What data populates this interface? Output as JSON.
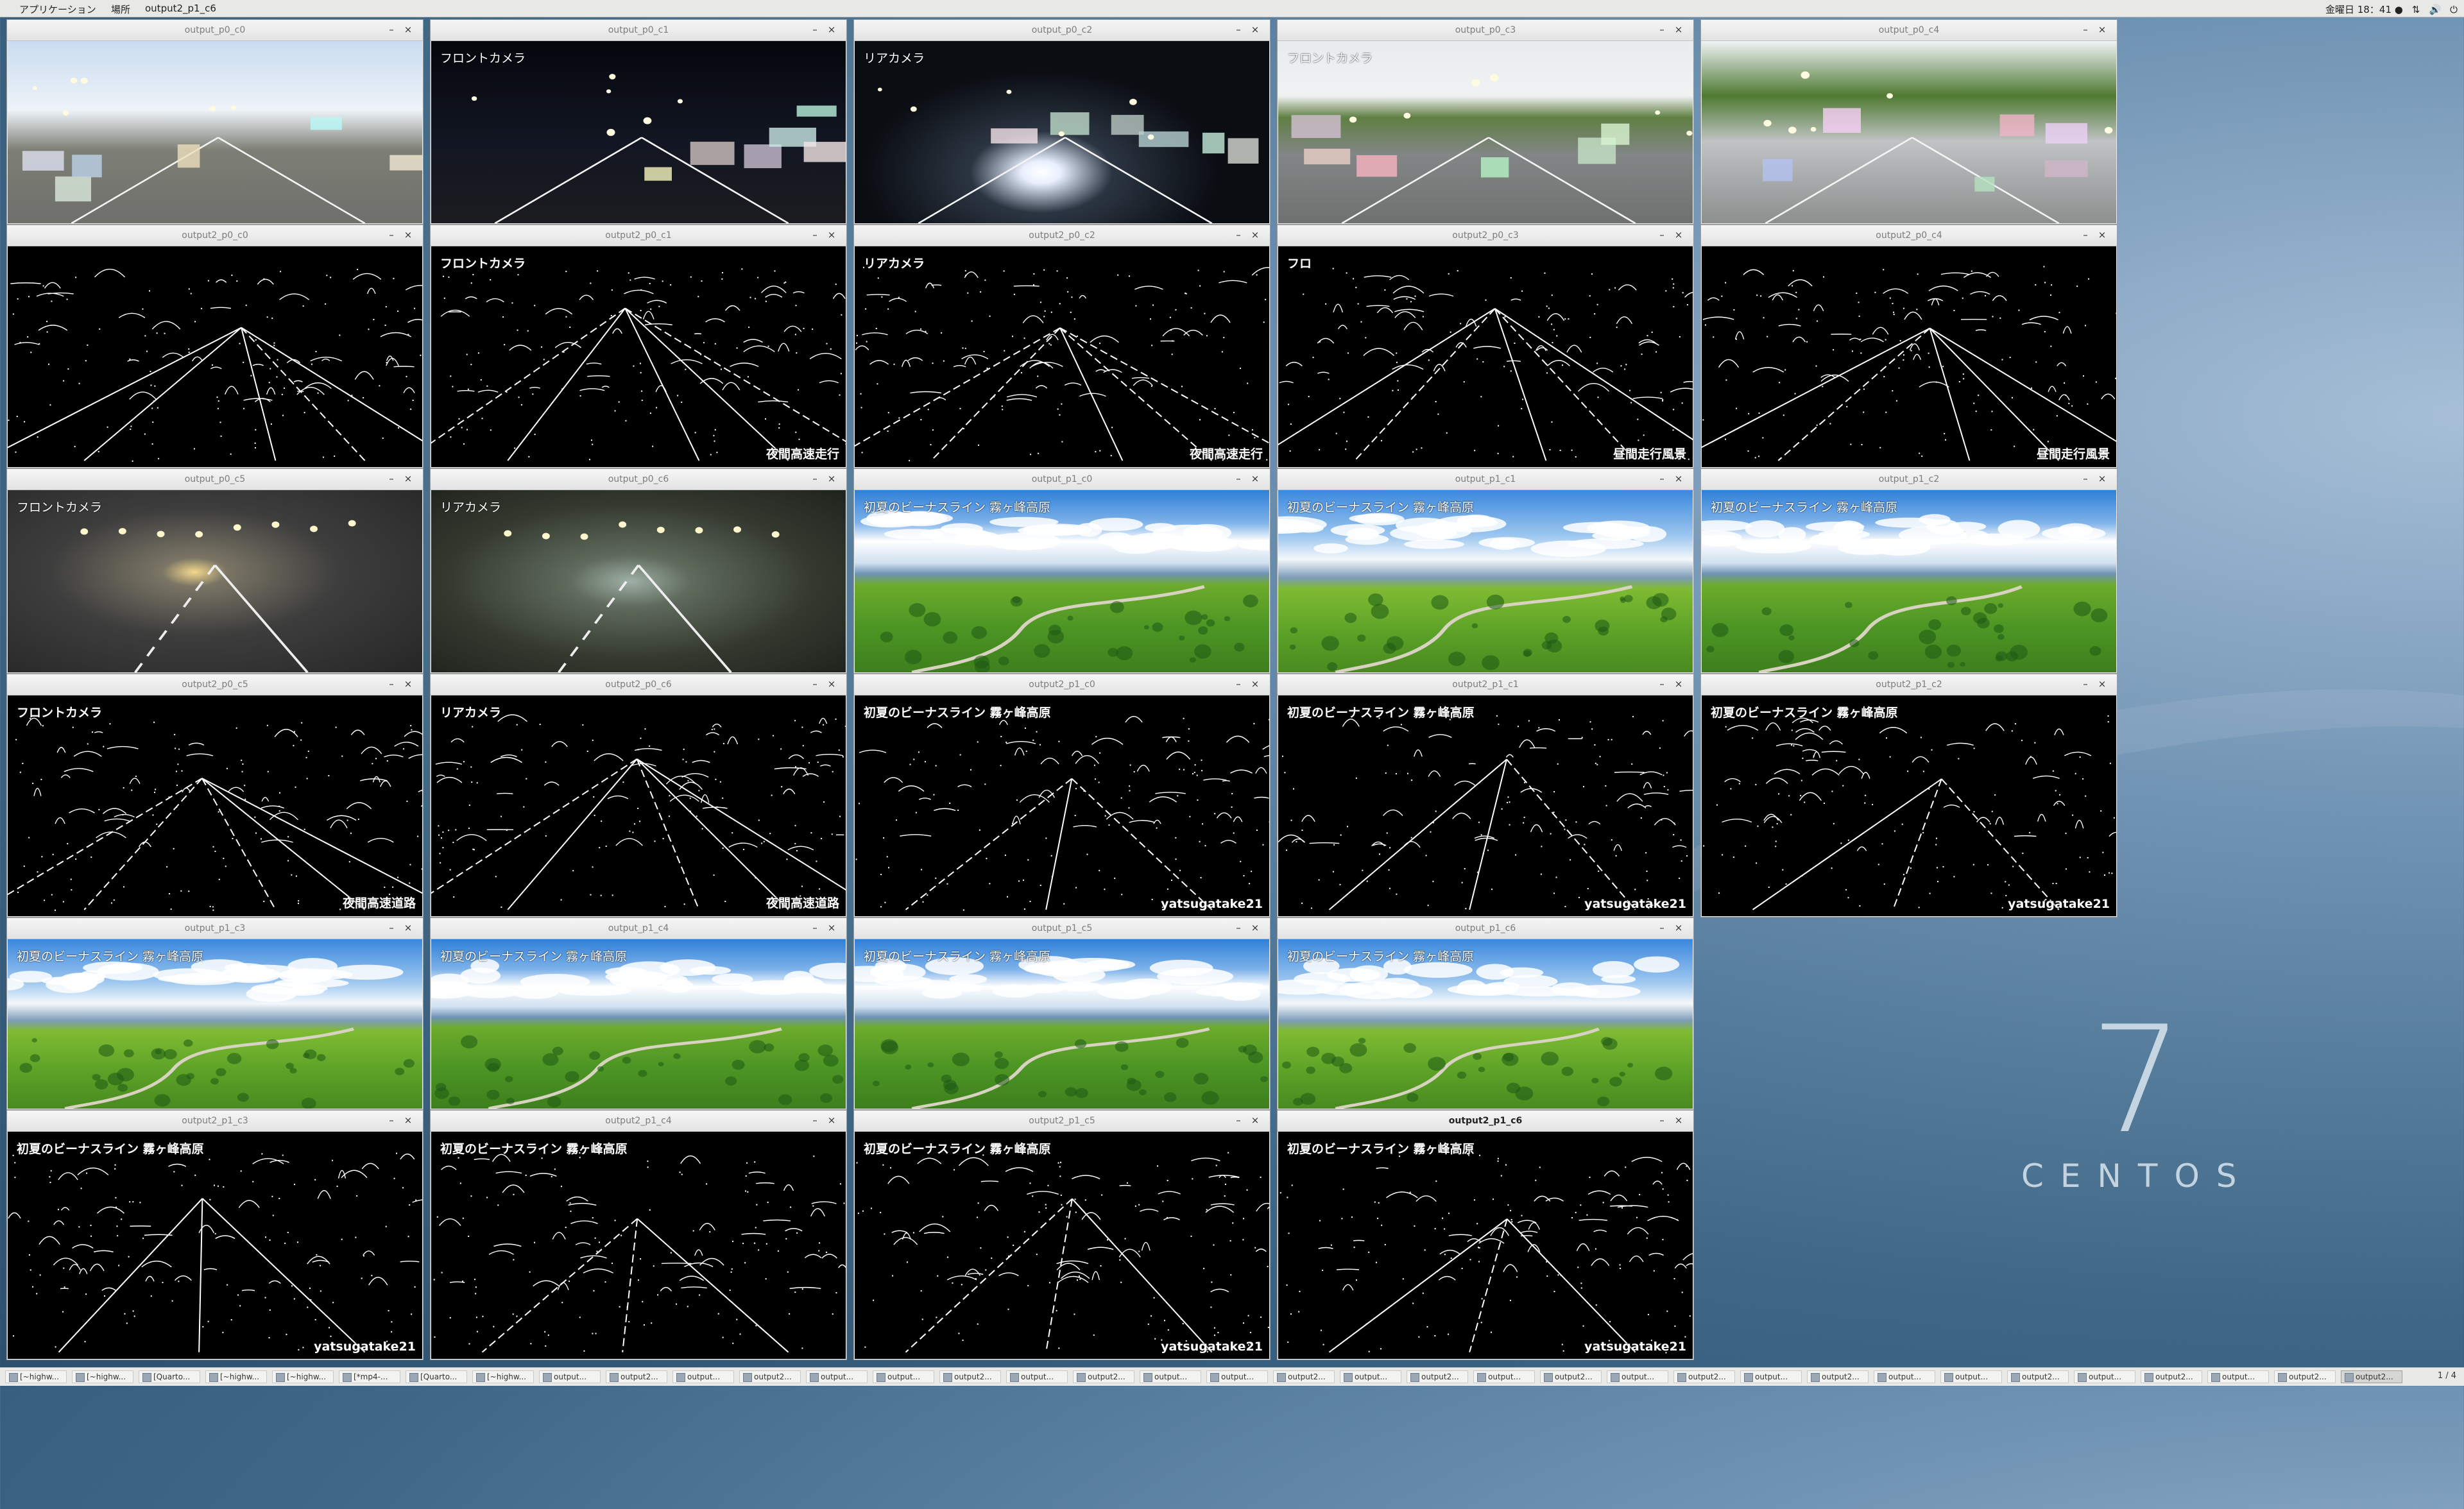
{
  "top_panel": {
    "applications": "アプリケーション",
    "places": "場所",
    "active_window": "output2_p1_c6",
    "clock": "金曜日 18：41 ●",
    "tray_icons": [
      "network-icon",
      "volume-icon",
      "power-icon"
    ]
  },
  "desktop": {
    "logo_number": "7",
    "logo_text": "CENTOS"
  },
  "windows": [
    {
      "title": "output_p0_c0",
      "overlay": "",
      "overlay2": "",
      "scene": "sc-day",
      "kind": "photo"
    },
    {
      "title": "output_p0_c1",
      "overlay": "フロントカメラ",
      "overlay2": "",
      "scene": "sc-night",
      "kind": "photo"
    },
    {
      "title": "output_p0_c2",
      "overlay": "リアカメラ",
      "overlay2": "",
      "scene": "sc-rear-night",
      "kind": "photo"
    },
    {
      "title": "output_p0_c3",
      "overlay": "フロントカメラ",
      "overlay2": "",
      "scene": "sc-overpass",
      "kind": "photo"
    },
    {
      "title": "output_p0_c4",
      "overlay": "",
      "overlay2": "",
      "scene": "sc-highway",
      "kind": "photo"
    },
    {
      "title": "output2_p0_c0",
      "overlay": "",
      "overlay2": "",
      "scene": "edge",
      "kind": "edge"
    },
    {
      "title": "output2_p0_c1",
      "overlay": "フロントカメラ",
      "overlay2": "夜間高速走行",
      "scene": "edge",
      "kind": "edge"
    },
    {
      "title": "output2_p0_c2",
      "overlay": "リアカメラ",
      "overlay2": "夜間高速走行",
      "scene": "edge",
      "kind": "edge"
    },
    {
      "title": "output2_p0_c3",
      "overlay": "フロ",
      "overlay2": "昼間走行風景",
      "scene": "edge",
      "kind": "edge"
    },
    {
      "title": "output2_p0_c4",
      "overlay": "",
      "overlay2": "昼間走行風景",
      "scene": "edge",
      "kind": "edge"
    },
    {
      "title": "output_p0_c5",
      "overlay": "フロントカメラ",
      "overlay2": "",
      "scene": "sc-tunnel",
      "kind": "photo"
    },
    {
      "title": "output_p0_c6",
      "overlay": "リアカメラ",
      "overlay2": "",
      "scene": "sc-tunnel2",
      "kind": "photo"
    },
    {
      "title": "output_p1_c0",
      "overlay": "初夏のビーナスライン 霧ヶ峰高原",
      "overlay2": "",
      "scene": "sc-green",
      "kind": "photo"
    },
    {
      "title": "output_p1_c1",
      "overlay": "初夏のビーナスライン 霧ヶ峰高原",
      "overlay2": "",
      "scene": "sc-green2",
      "kind": "photo"
    },
    {
      "title": "output_p1_c2",
      "overlay": "初夏のビーナスライン 霧ヶ峰高原",
      "overlay2": "",
      "scene": "sc-green",
      "kind": "photo"
    },
    {
      "title": "output2_p0_c5",
      "overlay": "フロントカメラ",
      "overlay2": "夜間高速道路",
      "scene": "edge",
      "kind": "edge"
    },
    {
      "title": "output2_p0_c6",
      "overlay": "リアカメラ",
      "overlay2": "夜間高速道路",
      "scene": "edge",
      "kind": "edge"
    },
    {
      "title": "output2_p1_c0",
      "overlay": "初夏のビーナスライン 霧ヶ峰高原",
      "overlay2": "yatsugatake21",
      "scene": "edge",
      "kind": "edge"
    },
    {
      "title": "output2_p1_c1",
      "overlay": "初夏のビーナスライン 霧ヶ峰高原",
      "overlay2": "yatsugatake21",
      "scene": "edge",
      "kind": "edge"
    },
    {
      "title": "output2_p1_c2",
      "overlay": "初夏のビーナスライン 霧ヶ峰高原",
      "overlay2": "yatsugatake21",
      "scene": "edge",
      "kind": "edge"
    },
    {
      "title": "output_p1_c3",
      "overlay": "初夏のビーナスライン 霧ヶ峰高原",
      "overlay2": "",
      "scene": "sc-green2",
      "kind": "photo"
    },
    {
      "title": "output_p1_c4",
      "overlay": "初夏のビーナスライン 霧ヶ峰高原",
      "overlay2": "",
      "scene": "sc-green",
      "kind": "photo"
    },
    {
      "title": "output_p1_c5",
      "overlay": "初夏のビーナスライン 霧ヶ峰高原",
      "overlay2": "",
      "scene": "sc-green",
      "kind": "photo"
    },
    {
      "title": "output_p1_c6",
      "overlay": "初夏のビーナスライン 霧ヶ峰高原",
      "overlay2": "",
      "scene": "sc-green2",
      "kind": "photo"
    },
    {
      "title": "output2_p1_c3",
      "overlay": "初夏のビーナスライン 霧ヶ峰高原",
      "overlay2": "yatsugatake21",
      "scene": "edge",
      "kind": "edge"
    },
    {
      "title": "output2_p1_c4",
      "overlay": "初夏のビーナスライン 霧ヶ峰高原",
      "overlay2": "",
      "scene": "edge",
      "kind": "edge"
    },
    {
      "title": "output2_p1_c5",
      "overlay": "初夏のビーナスライン 霧ヶ峰高原",
      "overlay2": "yatsugatake21",
      "scene": "edge",
      "kind": "edge"
    },
    {
      "title": "output2_p1_c6",
      "overlay": "初夏のビーナスライン 霧ヶ峰高原",
      "overlay2": "yatsugatake21",
      "scene": "edge",
      "kind": "edge",
      "active": true
    }
  ],
  "window_controls": {
    "minimize": "–",
    "close": "×"
  },
  "taskbar": {
    "items": [
      "[~highw...",
      "[~highw...",
      "[Quarto...",
      "[~highw...",
      "[~highw...",
      "[*mp4-...",
      "[Quarto...",
      "[~highw...",
      "output...",
      "output2...",
      "output...",
      "output2...",
      "output...",
      "output...",
      "output2...",
      "output...",
      "output2...",
      "output...",
      "output...",
      "output2...",
      "output...",
      "output2...",
      "output...",
      "output2...",
      "output...",
      "output2...",
      "output...",
      "output2...",
      "output...",
      "output...",
      "output2...",
      "output...",
      "output2...",
      "output...",
      "output2...",
      "output2..."
    ],
    "active_index": 35,
    "workspace": "1 / 4"
  }
}
